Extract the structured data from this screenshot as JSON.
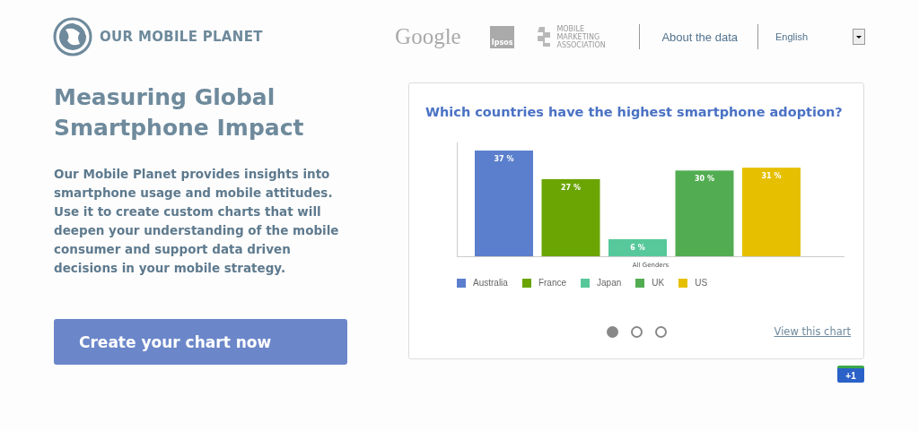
{
  "header": {
    "brand": "OUR MOBILE PLANET",
    "partners": [
      {
        "kind": "google",
        "name": "Google"
      },
      {
        "kind": "ipsos",
        "name": "Ipsos"
      },
      {
        "kind": "mma",
        "name": "MOBILE MARKETING ASSOCIATION"
      }
    ],
    "about_link": "About the data",
    "language": "English"
  },
  "hero": {
    "title": "Measuring Global Smartphone Impact",
    "description": "Our Mobile Planet provides insights into smartphone usage and mobile attitudes. Use it to create custom charts that will deepen your understanding of the mobile consumer and support data driven decisions in your mobile strategy.",
    "button": "Create your chart now"
  },
  "chart_card": {
    "title": "Which countries have the highest smartphone adoption?",
    "chart_data": {
      "type": "bar",
      "xlabel": "All Genders",
      "categories": [
        null
      ],
      "series": [
        {
          "name": "Australia",
          "color": "#5b7fcc",
          "values": [
            37
          ],
          "value_labels": [
            "37 %"
          ]
        },
        {
          "name": "France",
          "color": "#6aa504",
          "values": [
            27
          ],
          "value_labels": [
            "27 %"
          ]
        },
        {
          "name": "Japan",
          "color": "#57c89a",
          "values": [
            6
          ],
          "value_labels": [
            "6 %"
          ]
        },
        {
          "name": "UK",
          "color": "#52ad52",
          "values": [
            30
          ],
          "value_labels": [
            "30 %"
          ]
        },
        {
          "name": "US",
          "color": "#e6c000",
          "values": [
            31
          ],
          "value_labels": [
            "31 %"
          ]
        }
      ]
    },
    "slides": [
      {
        "selected": true
      },
      {
        "selected": false
      },
      {
        "selected": false
      }
    ],
    "view_link": "View this chart"
  },
  "plus_one": "+1"
}
